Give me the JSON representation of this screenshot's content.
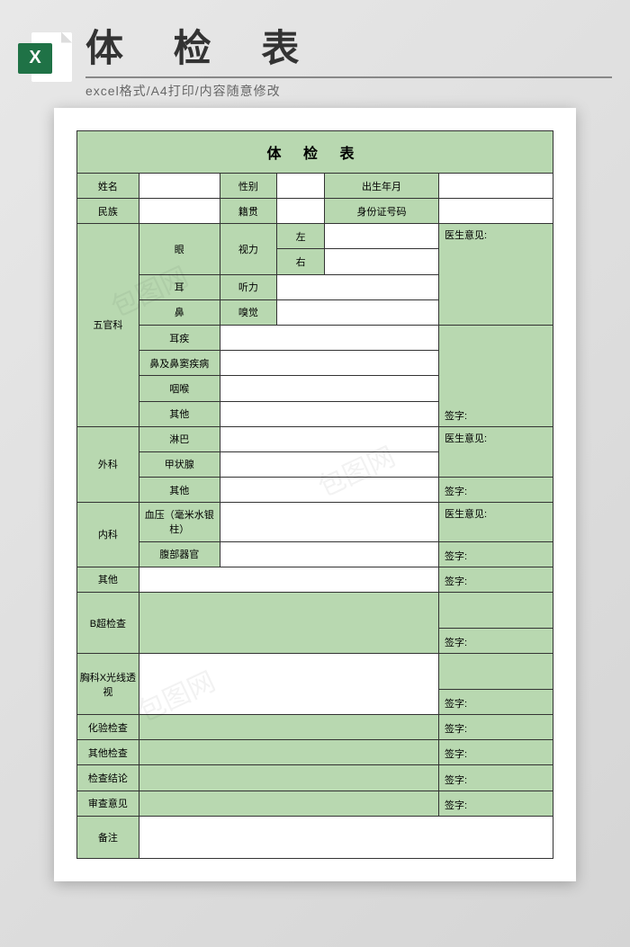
{
  "header": {
    "icon_letter": "X",
    "main_title": "体 检 表",
    "sub_title": "excel格式/A4打印/内容随意修改"
  },
  "form": {
    "title": "体 检 表",
    "row1": {
      "name": "姓名",
      "sex": "性别",
      "dob": "出生年月"
    },
    "row2": {
      "nation": "民族",
      "origin": "籍贯",
      "id": "身份证号码"
    },
    "ent": {
      "dept": "五官科",
      "eye": "眼",
      "vision": "视力",
      "left": "左",
      "right": "右",
      "ear": "耳",
      "hearing": "听力",
      "nose": "鼻",
      "smell": "嗅觉",
      "ear_disease": "耳疾",
      "nose_disease": "鼻及鼻窦疾病",
      "throat": "咽喉",
      "other": "其他",
      "opinion": "医生意见:",
      "sign": "签字:"
    },
    "surgery": {
      "dept": "外科",
      "lymph": "淋巴",
      "thyroid": "甲状腺",
      "other": "其他",
      "opinion": "医生意见:",
      "sign": "签字:"
    },
    "internal": {
      "dept": "内科",
      "bp": "血压（毫米水银柱）",
      "abdomen": "腹部器官",
      "opinion": "医生意见:",
      "sign": "签字:"
    },
    "other_row": {
      "label": "其他",
      "sign": "签字:"
    },
    "bscan": {
      "label": "B超检查",
      "sign": "签字:"
    },
    "xray": {
      "label": "胸科X光线透视",
      "sign": "签字:"
    },
    "lab": {
      "label": "化验检查",
      "sign": "签字:"
    },
    "other_exam": {
      "label": "其他检查",
      "sign": "签字:"
    },
    "conclusion": {
      "label": "检查结论",
      "sign": "签字:"
    },
    "review": {
      "label": "审查意见",
      "sign": "签字:"
    },
    "remark": {
      "label": "备注"
    }
  }
}
